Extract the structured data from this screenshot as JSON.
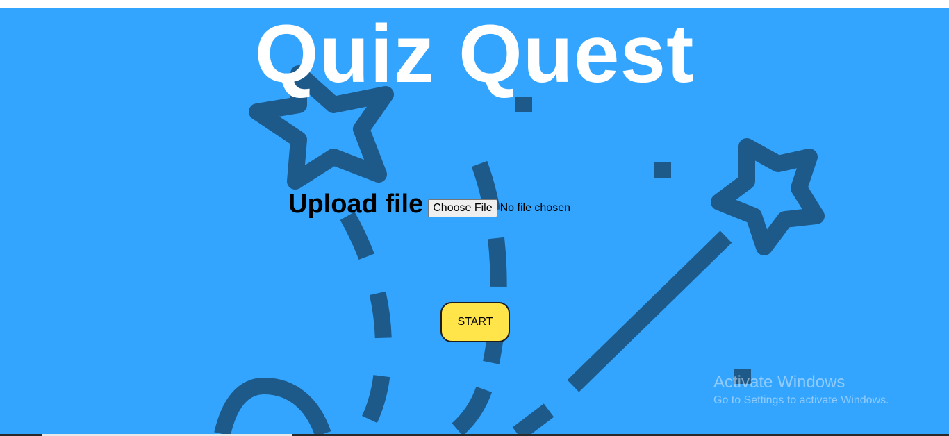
{
  "app": {
    "title": "Quiz Quest"
  },
  "upload": {
    "label": "Upload file",
    "button_label": "Choose File",
    "status": "No file chosen"
  },
  "actions": {
    "start_label": "START"
  },
  "watermark": {
    "title": "Activate Windows",
    "subtitle": "Go to Settings to activate Windows."
  },
  "colors": {
    "background": "#34a5fe",
    "art": "#1d5a8a",
    "start_button": "#ffe54a",
    "title": "#ffffff"
  },
  "icons": {
    "background_art": "magic-wand-stars-illustration"
  }
}
